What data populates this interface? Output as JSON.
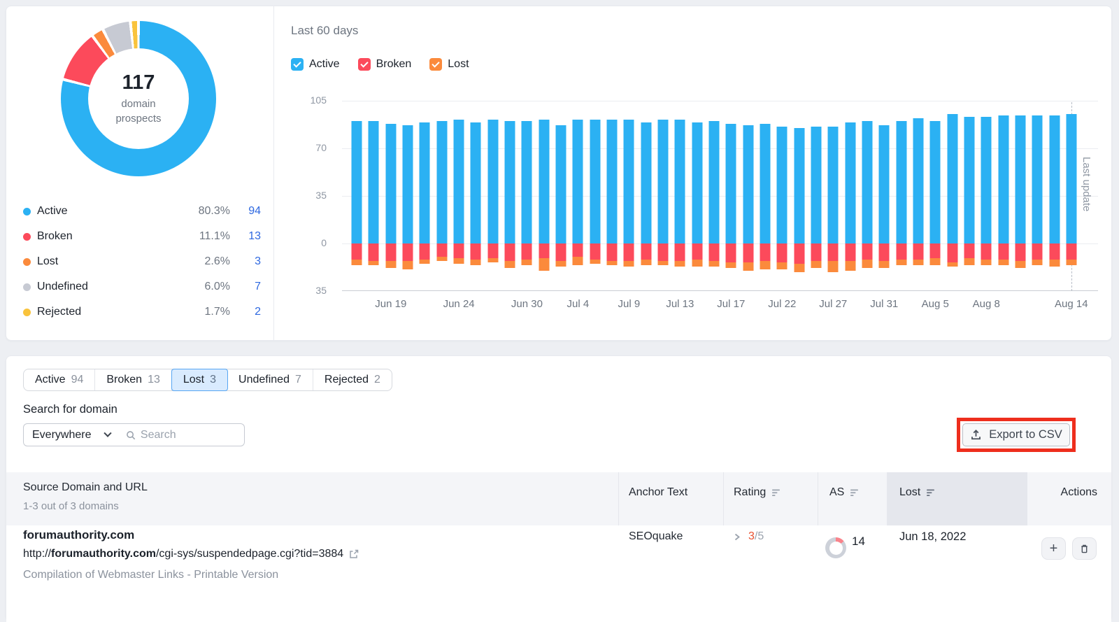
{
  "colors": {
    "active": "#2bb1f3",
    "broken": "#fc4a5b",
    "lost": "#fb8a3c",
    "undefined": "#c7cad3",
    "rejected": "#f9c33c",
    "count_link": "#2e68e0",
    "rating": "#e8502f",
    "annotation": "#ee2e1d",
    "gauge_track": "#cdd1d9",
    "gauge_arc": "#f9838b"
  },
  "prospects": {
    "total": "117",
    "center_caption": "domain prospects",
    "legend": [
      {
        "label": "Active",
        "percent": "80.3%",
        "count": "94",
        "color_key": "active"
      },
      {
        "label": "Broken",
        "percent": "11.1%",
        "count": "13",
        "color_key": "broken"
      },
      {
        "label": "Lost",
        "percent": "2.6%",
        "count": "3",
        "color_key": "lost"
      },
      {
        "label": "Undefined",
        "percent": "6.0%",
        "count": "7",
        "color_key": "undefined"
      },
      {
        "label": "Rejected",
        "percent": "1.7%",
        "count": "2",
        "color_key": "rejected"
      }
    ]
  },
  "trend": {
    "title": "Last 60 days",
    "filters": [
      {
        "label": "Active",
        "checked": true,
        "color_key": "active"
      },
      {
        "label": "Broken",
        "checked": true,
        "color_key": "broken"
      },
      {
        "label": "Lost",
        "checked": true,
        "color_key": "lost"
      }
    ],
    "last_update_label": "Last update"
  },
  "chart_data": {
    "type": "bar",
    "stacked": true,
    "title": "Last 60 days",
    "ylim": [
      -35,
      105
    ],
    "y_ticks": [
      {
        "value": 105,
        "label": "105"
      },
      {
        "value": 70,
        "label": "70"
      },
      {
        "value": 35,
        "label": "35"
      },
      {
        "value": 0,
        "label": "0"
      },
      {
        "value": -35,
        "label": "35"
      }
    ],
    "num_bars": 43,
    "x_tick_labels": [
      {
        "index": 2,
        "label": "Jun 19"
      },
      {
        "index": 6,
        "label": "Jun 24"
      },
      {
        "index": 10,
        "label": "Jun 30"
      },
      {
        "index": 13,
        "label": "Jul 4"
      },
      {
        "index": 16,
        "label": "Jul 9"
      },
      {
        "index": 19,
        "label": "Jul 13"
      },
      {
        "index": 22,
        "label": "Jul 17"
      },
      {
        "index": 25,
        "label": "Jul 22"
      },
      {
        "index": 28,
        "label": "Jul 27"
      },
      {
        "index": 31,
        "label": "Jul 31"
      },
      {
        "index": 34,
        "label": "Aug 5"
      },
      {
        "index": 37,
        "label": "Aug 8"
      },
      {
        "index": 42,
        "label": "Aug 14"
      }
    ],
    "last_update_index": 42,
    "series": [
      {
        "name": "Active",
        "color_key": "active",
        "direction": "up",
        "values": [
          90,
          90,
          88,
          87,
          89,
          90,
          91,
          89,
          91,
          90,
          90,
          91,
          87,
          91,
          91,
          91,
          91,
          89,
          91,
          91,
          89,
          90,
          88,
          87,
          88,
          86,
          85,
          86,
          86,
          89,
          90,
          87,
          90,
          92,
          90,
          95,
          93,
          93,
          94,
          94,
          94,
          94,
          95
        ]
      },
      {
        "name": "Broken",
        "color_key": "broken",
        "direction": "down",
        "values": [
          12,
          13,
          13,
          13,
          12,
          10,
          11,
          12,
          11,
          13,
          12,
          11,
          13,
          10,
          12,
          13,
          13,
          12,
          13,
          13,
          12,
          13,
          14,
          14,
          13,
          14,
          15,
          13,
          13,
          13,
          12,
          13,
          12,
          12,
          11,
          14,
          11,
          12,
          12,
          13,
          12,
          12,
          12
        ]
      },
      {
        "name": "Lost",
        "color_key": "lost",
        "direction": "down",
        "values": [
          4,
          3,
          5,
          6,
          3,
          3,
          4,
          4,
          3,
          5,
          4,
          9,
          4,
          6,
          3,
          3,
          4,
          4,
          3,
          4,
          5,
          4,
          4,
          6,
          6,
          5,
          6,
          5,
          8,
          7,
          6,
          5,
          4,
          4,
          5,
          3,
          5,
          4,
          4,
          5,
          4,
          5,
          4
        ]
      }
    ]
  },
  "tabs": [
    {
      "label": "Active",
      "count": "94",
      "selected": false
    },
    {
      "label": "Broken",
      "count": "13",
      "selected": false
    },
    {
      "label": "Lost",
      "count": "3",
      "selected": true
    },
    {
      "label": "Undefined",
      "count": "7",
      "selected": false
    },
    {
      "label": "Rejected",
      "count": "2",
      "selected": false
    }
  ],
  "search": {
    "label": "Search for domain",
    "scope": "Everywhere",
    "placeholder": "Search"
  },
  "toolbar": {
    "export_label": "Export to CSV"
  },
  "table": {
    "source_header": "Source Domain and URL",
    "source_sub": "1-3 out of 3 domains",
    "columns": [
      {
        "label": "Anchor Text",
        "sort": false,
        "active": false
      },
      {
        "label": "Rating",
        "sort": true,
        "active": false
      },
      {
        "label": "AS",
        "sort": true,
        "active": false
      },
      {
        "label": "Lost",
        "sort": true,
        "active": true
      },
      {
        "label": "Actions",
        "sort": false,
        "active": false
      }
    ],
    "rows": [
      {
        "domain": "forumauthority.com",
        "url_prefix": "http://",
        "url_domain": "forumauthority.com",
        "url_path": "/cgi-sys/suspendedpage.cgi?tid=3884",
        "description": "Compilation of Webmaster Links - Printable Version",
        "anchor_text": "SEOquake",
        "rating": "3",
        "rating_of": "/5",
        "as": "14",
        "lost": "Jun 18, 2022"
      }
    ]
  }
}
